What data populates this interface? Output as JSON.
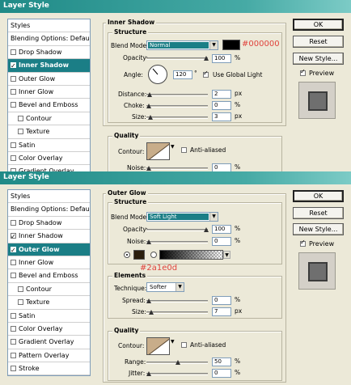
{
  "top": {
    "title": "Layer Style",
    "sidebar": {
      "header": "Styles",
      "items": [
        {
          "label": "Blending Options: Default",
          "checkbox": false,
          "checked": false,
          "indent": false,
          "selected": false
        },
        {
          "label": "Drop Shadow",
          "checkbox": true,
          "checked": false,
          "indent": false,
          "selected": false
        },
        {
          "label": "Inner Shadow",
          "checkbox": true,
          "checked": true,
          "indent": false,
          "selected": true
        },
        {
          "label": "Outer Glow",
          "checkbox": true,
          "checked": false,
          "indent": false,
          "selected": false
        },
        {
          "label": "Inner Glow",
          "checkbox": true,
          "checked": false,
          "indent": false,
          "selected": false
        },
        {
          "label": "Bevel and Emboss",
          "checkbox": true,
          "checked": false,
          "indent": false,
          "selected": false
        },
        {
          "label": "Contour",
          "checkbox": true,
          "checked": false,
          "indent": true,
          "selected": false
        },
        {
          "label": "Texture",
          "checkbox": true,
          "checked": false,
          "indent": true,
          "selected": false
        },
        {
          "label": "Satin",
          "checkbox": true,
          "checked": false,
          "indent": false,
          "selected": false
        },
        {
          "label": "Color Overlay",
          "checkbox": true,
          "checked": false,
          "indent": false,
          "selected": false
        },
        {
          "label": "Gradient Overlay",
          "checkbox": true,
          "checked": false,
          "indent": false,
          "selected": false
        }
      ]
    },
    "panel_title": "Inner Shadow",
    "structure": {
      "heading": "Structure",
      "blend_mode_label": "Blend Mode:",
      "blend_mode_value": "Normal",
      "color_annotation": "#000000",
      "opacity_label": "Opacity:",
      "opacity_value": "100",
      "angle_label": "Angle:",
      "angle_value": "120",
      "use_global_light_label": "Use Global Light",
      "distance_label": "Distance:",
      "distance_value": "2",
      "choke_label": "Choke:",
      "choke_value": "0",
      "size_label": "Size:",
      "size_value": "3",
      "px": "px",
      "pct": "%",
      "deg": "°"
    },
    "quality": {
      "heading": "Quality",
      "contour_label": "Contour:",
      "anti_aliased_label": "Anti-aliased",
      "noise_label": "Noise:",
      "noise_value": "0",
      "pct": "%"
    },
    "buttons": {
      "ok": "OK",
      "reset": "Reset",
      "new_style": "New Style...",
      "preview": "Preview"
    }
  },
  "bottom": {
    "title": "Layer Style",
    "sidebar": {
      "header": "Styles",
      "items": [
        {
          "label": "Blending Options: Default",
          "checkbox": false,
          "checked": false,
          "indent": false,
          "selected": false
        },
        {
          "label": "Drop Shadow",
          "checkbox": true,
          "checked": false,
          "indent": false,
          "selected": false
        },
        {
          "label": "Inner Shadow",
          "checkbox": true,
          "checked": true,
          "indent": false,
          "selected": false
        },
        {
          "label": "Outer Glow",
          "checkbox": true,
          "checked": true,
          "indent": false,
          "selected": true
        },
        {
          "label": "Inner Glow",
          "checkbox": true,
          "checked": false,
          "indent": false,
          "selected": false
        },
        {
          "label": "Bevel and Emboss",
          "checkbox": true,
          "checked": false,
          "indent": false,
          "selected": false
        },
        {
          "label": "Contour",
          "checkbox": true,
          "checked": false,
          "indent": true,
          "selected": false
        },
        {
          "label": "Texture",
          "checkbox": true,
          "checked": false,
          "indent": true,
          "selected": false
        },
        {
          "label": "Satin",
          "checkbox": true,
          "checked": false,
          "indent": false,
          "selected": false
        },
        {
          "label": "Color Overlay",
          "checkbox": true,
          "checked": false,
          "indent": false,
          "selected": false
        },
        {
          "label": "Gradient Overlay",
          "checkbox": true,
          "checked": false,
          "indent": false,
          "selected": false
        },
        {
          "label": "Pattern Overlay",
          "checkbox": true,
          "checked": false,
          "indent": false,
          "selected": false
        },
        {
          "label": "Stroke",
          "checkbox": true,
          "checked": false,
          "indent": false,
          "selected": false
        }
      ]
    },
    "panel_title": "Outer Glow",
    "structure": {
      "heading": "Structure",
      "blend_mode_label": "Blend Mode:",
      "blend_mode_value": "Soft Light",
      "opacity_label": "Opacity:",
      "opacity_value": "100",
      "noise_label": "Noise:",
      "noise_value": "0",
      "pct": "%",
      "color_annotation": "#2a1e0d"
    },
    "elements": {
      "heading": "Elements",
      "technique_label": "Technique:",
      "technique_value": "Softer",
      "spread_label": "Spread:",
      "spread_value": "0",
      "size_label": "Size:",
      "size_value": "7",
      "pct": "%",
      "px": "px"
    },
    "quality": {
      "heading": "Quality",
      "contour_label": "Contour:",
      "anti_aliased_label": "Anti-aliased",
      "range_label": "Range:",
      "range_value": "50",
      "jitter_label": "Jitter:",
      "jitter_value": "0",
      "pct": "%"
    },
    "buttons": {
      "ok": "OK",
      "reset": "Reset",
      "new_style": "New Style...",
      "preview": "Preview"
    }
  },
  "colors": {
    "title_bar": "#1f8a87",
    "selection": "#1b7e86",
    "dialog_bg": "#ece9d8",
    "annotation": "#e0423c",
    "inner_shadow_color": "#000000",
    "outer_glow_color": "#2a1e0d"
  }
}
